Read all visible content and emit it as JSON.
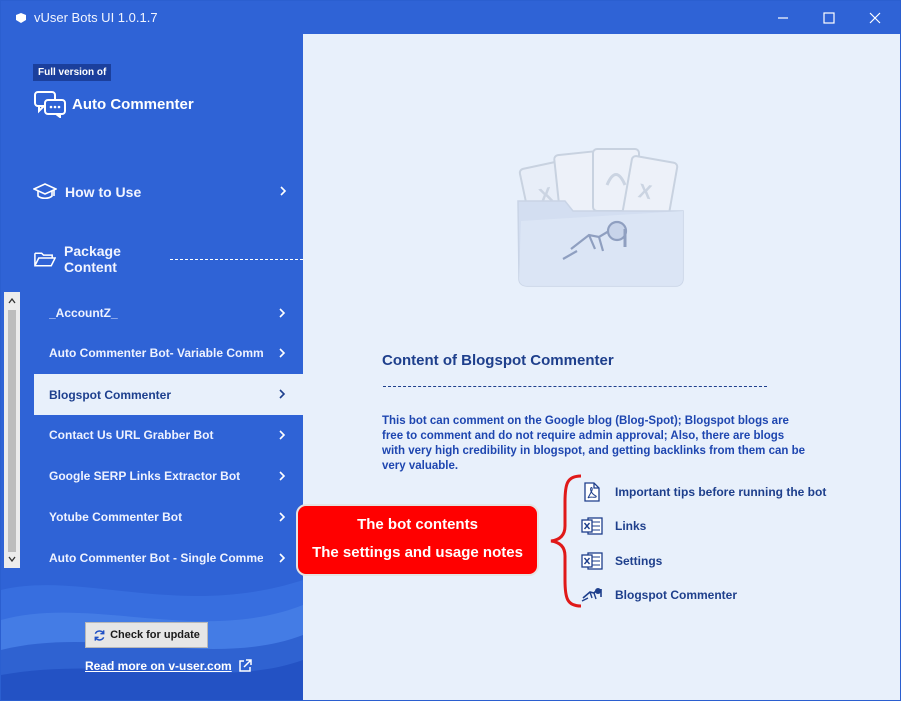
{
  "window": {
    "title": "vUser Bots UI 1.0.1.7",
    "controls": [
      "minimize-icon",
      "maximize-icon",
      "close-icon"
    ]
  },
  "sidebar": {
    "badge": "Full version of",
    "brand": "Auto Commenter",
    "how_to_use": "How to Use",
    "package_content": "Package Content",
    "items": [
      {
        "label": "_AccountZ_",
        "active": false
      },
      {
        "label": "Auto Commenter Bot- Variable Comment Version",
        "active": false
      },
      {
        "label": "Blogspot Commenter",
        "active": true
      },
      {
        "label": "Contact Us URL Grabber Bot",
        "active": false
      },
      {
        "label": "Google SERP Links Extractor Bot",
        "active": false
      },
      {
        "label": "Yotube Commenter Bot",
        "active": false
      },
      {
        "label": "Auto Commenter Bot - Single Comment",
        "active": false
      }
    ],
    "check_update": "Check for update",
    "read_more": "Read more on v-user.com"
  },
  "main": {
    "title": "Content of Blogspot Commenter",
    "description": "This bot can comment on the Google blog (Blog-Spot); Blogspot blogs are free to comment and do not require admin approval; Also, there are blogs with very high credibility in blogspot, and getting backlinks from them can be very valuable.",
    "files": [
      {
        "label": "Important tips before running the bot",
        "icon": "pdf-icon"
      },
      {
        "label": "Links",
        "icon": "excel-icon"
      },
      {
        "label": "Settings",
        "icon": "excel-icon"
      },
      {
        "label": "Blogspot Commenter",
        "icon": "bot-icon"
      }
    ],
    "callout": {
      "line1": "The bot contents",
      "line2": "The settings and usage notes"
    }
  },
  "colors": {
    "sidebar": "#2f63d6",
    "accent_dark": "#1e3f8c",
    "panel": "#e8f0fb",
    "callout": "#ff0000"
  }
}
